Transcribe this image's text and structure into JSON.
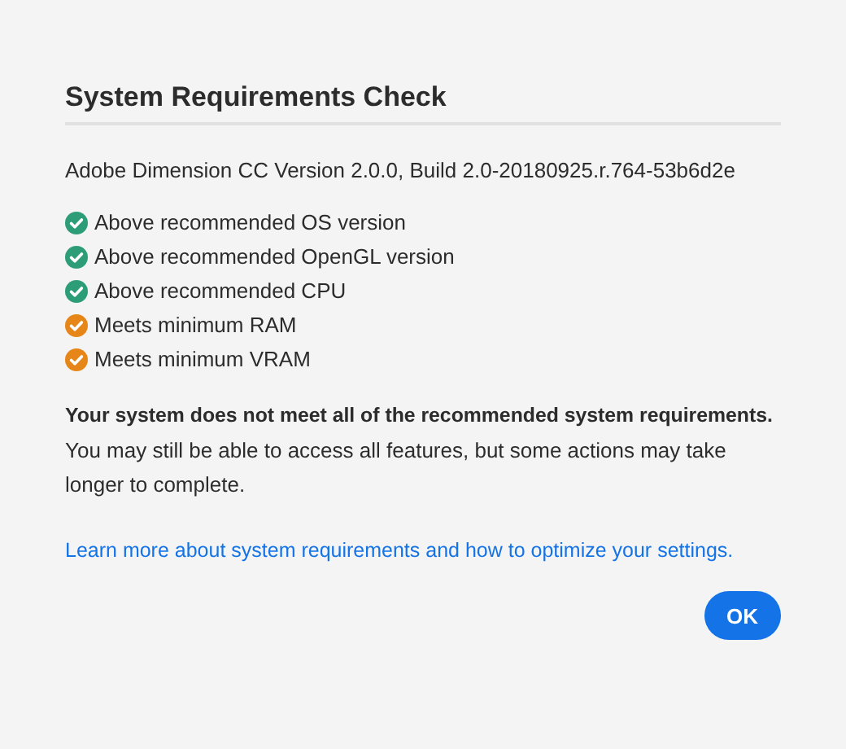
{
  "dialog": {
    "title": "System Requirements Check",
    "version": "Adobe Dimension CC Version 2.0.0, Build 2.0-20180925.r.764-53b6d2e",
    "checks": [
      {
        "label": "Above recommended OS version",
        "color": "#2d9d78"
      },
      {
        "label": "Above recommended OpenGL version",
        "color": "#2d9d78"
      },
      {
        "label": "Above recommended CPU",
        "color": "#2d9d78"
      },
      {
        "label": "Meets minimum RAM",
        "color": "#e68619"
      },
      {
        "label": "Meets minimum VRAM",
        "color": "#e68619"
      }
    ],
    "summary": "Your system does not meet all of the recommended system requirements.",
    "detail": "You may still be able to access all features, but some actions may take longer to complete.",
    "link": "Learn more about system requirements and how to optimize your settings.",
    "buttons": [
      "OK"
    ]
  }
}
